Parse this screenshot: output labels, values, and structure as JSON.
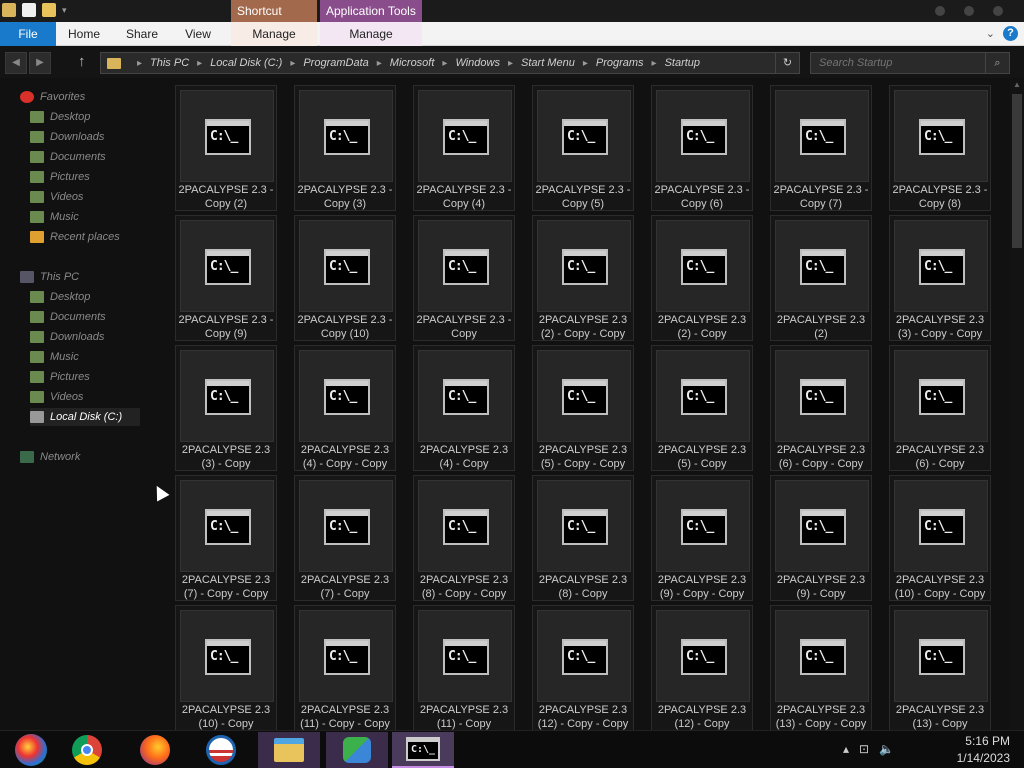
{
  "ribbon": {
    "context_tabs": [
      "Shortcut Tools",
      "Application Tools"
    ],
    "tabs": [
      "File",
      "Home",
      "Share",
      "View",
      "Manage",
      "Manage"
    ]
  },
  "address": {
    "crumbs": [
      "This PC",
      "Local Disk (C:)",
      "ProgramData",
      "Microsoft",
      "Windows",
      "Start Menu",
      "Programs",
      "Startup"
    ],
    "search_placeholder": "Search Startup"
  },
  "nav": {
    "favorites": "Favorites",
    "favorites_items": [
      "Desktop",
      "Downloads",
      "Documents",
      "Pictures",
      "Videos",
      "Music",
      "Recent places"
    ],
    "this_pc": "This PC",
    "this_pc_items": [
      "Desktop",
      "Documents",
      "Downloads",
      "Music",
      "Pictures",
      "Videos",
      "Local Disk (C:)"
    ],
    "network": "Network"
  },
  "files": [
    [
      "2PACALYPSE 2.3 -",
      "Copy (2)"
    ],
    [
      "2PACALYPSE 2.3 -",
      "Copy (3)"
    ],
    [
      "2PACALYPSE 2.3 -",
      "Copy (4)"
    ],
    [
      "2PACALYPSE 2.3 -",
      "Copy (5)"
    ],
    [
      "2PACALYPSE 2.3 -",
      "Copy (6)"
    ],
    [
      "2PACALYPSE 2.3 -",
      "Copy (7)"
    ],
    [
      "2PACALYPSE 2.3 -",
      "Copy (8)"
    ],
    [
      "2PACALYPSE 2.3 -",
      "Copy (9)"
    ],
    [
      "2PACALYPSE 2.3 -",
      "Copy (10)"
    ],
    [
      "2PACALYPSE 2.3 -",
      "Copy"
    ],
    [
      "2PACALYPSE 2.3",
      "(2) - Copy - Copy"
    ],
    [
      "2PACALYPSE 2.3",
      "(2) - Copy"
    ],
    [
      "2PACALYPSE 2.3",
      "(2)"
    ],
    [
      "2PACALYPSE 2.3",
      "(3) - Copy - Copy"
    ],
    [
      "2PACALYPSE 2.3",
      "(3) - Copy"
    ],
    [
      "2PACALYPSE 2.3",
      "(4) - Copy - Copy"
    ],
    [
      "2PACALYPSE 2.3",
      "(4) - Copy"
    ],
    [
      "2PACALYPSE 2.3",
      "(5) - Copy - Copy"
    ],
    [
      "2PACALYPSE 2.3",
      "(5) - Copy"
    ],
    [
      "2PACALYPSE 2.3",
      "(6) - Copy - Copy"
    ],
    [
      "2PACALYPSE 2.3",
      "(6) - Copy"
    ],
    [
      "2PACALYPSE 2.3",
      "(7) - Copy - Copy"
    ],
    [
      "2PACALYPSE 2.3",
      "(7) - Copy"
    ],
    [
      "2PACALYPSE 2.3",
      "(8) - Copy - Copy"
    ],
    [
      "2PACALYPSE 2.3",
      "(8) - Copy"
    ],
    [
      "2PACALYPSE 2.3",
      "(9) - Copy - Copy"
    ],
    [
      "2PACALYPSE 2.3",
      "(9) - Copy"
    ],
    [
      "2PACALYPSE 2.3",
      "(10) - Copy - Copy"
    ],
    [
      "2PACALYPSE 2.3",
      "(10) - Copy"
    ],
    [
      "2PACALYPSE 2.3",
      "(11) - Copy - Copy"
    ],
    [
      "2PACALYPSE 2.3",
      "(11) - Copy"
    ],
    [
      "2PACALYPSE 2.3",
      "(12) - Copy - Copy"
    ],
    [
      "2PACALYPSE 2.3",
      "(12) - Copy"
    ],
    [
      "2PACALYPSE 2.3",
      "(13) - Copy - Copy"
    ],
    [
      "2PACALYPSE 2.3",
      "(13) - Copy"
    ]
  ],
  "file_icon_text": "C:\\_",
  "taskbar": {
    "apps": [
      "start-orb-icon",
      "chrome-icon",
      "firefox-icon",
      "obama-logo-icon",
      "file-explorer-icon",
      "users-app-icon",
      "cmd-icon"
    ],
    "time": "5:16 PM",
    "date": "1/14/2023"
  },
  "colors": {
    "file_tab": "#1979ca",
    "shortcut_tools": "#a2694c",
    "application_tools": "#8a4d8c"
  }
}
